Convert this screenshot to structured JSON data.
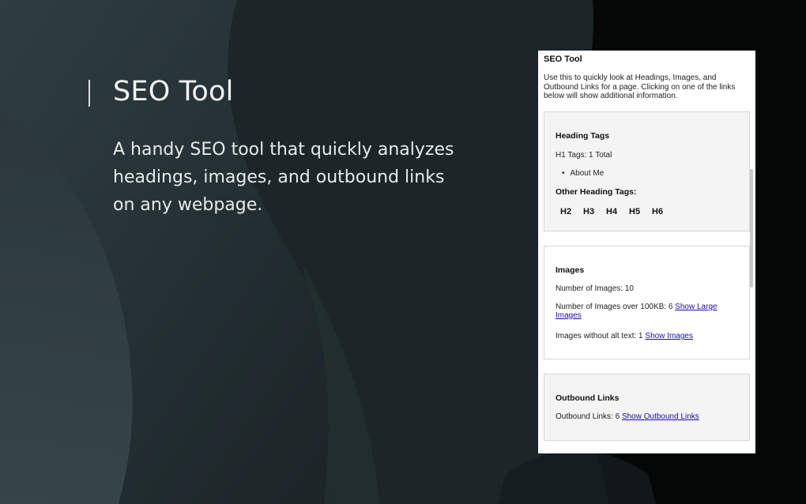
{
  "hero": {
    "title": "SEO Tool",
    "description": "A handy SEO tool that quickly analyzes headings, images, and outbound links on any webpage."
  },
  "panel": {
    "title": "SEO Tool",
    "intro": "Use this to quickly look at Headings, Images, and Outbound Links for a page. Clicking on one of the links below will show additional information.",
    "headings": {
      "heading": "Heading Tags",
      "h1_count": "H1 Tags: 1 Total",
      "h1_items": [
        "About Me"
      ],
      "other_label": "Other Heading Tags:",
      "tags": [
        "H2",
        "H3",
        "H4",
        "H5",
        "H6"
      ]
    },
    "images": {
      "heading": "Images",
      "count": "Number of Images: 10",
      "large_prefix": "Number of Images over 100KB: 6",
      "large_link": "Show Large Images",
      "noalt_prefix": "Images without alt text: 1",
      "noalt_link": "Show Images"
    },
    "links": {
      "heading": "Outbound Links",
      "count_prefix": "Outbound Links: 6",
      "link": "Show Outbound Links"
    }
  },
  "colors": {
    "background_dark": "#1f2a2e",
    "panel_bg": "#ffffff",
    "card_bg": "#f4f4f4",
    "link": "#1a0dab"
  }
}
